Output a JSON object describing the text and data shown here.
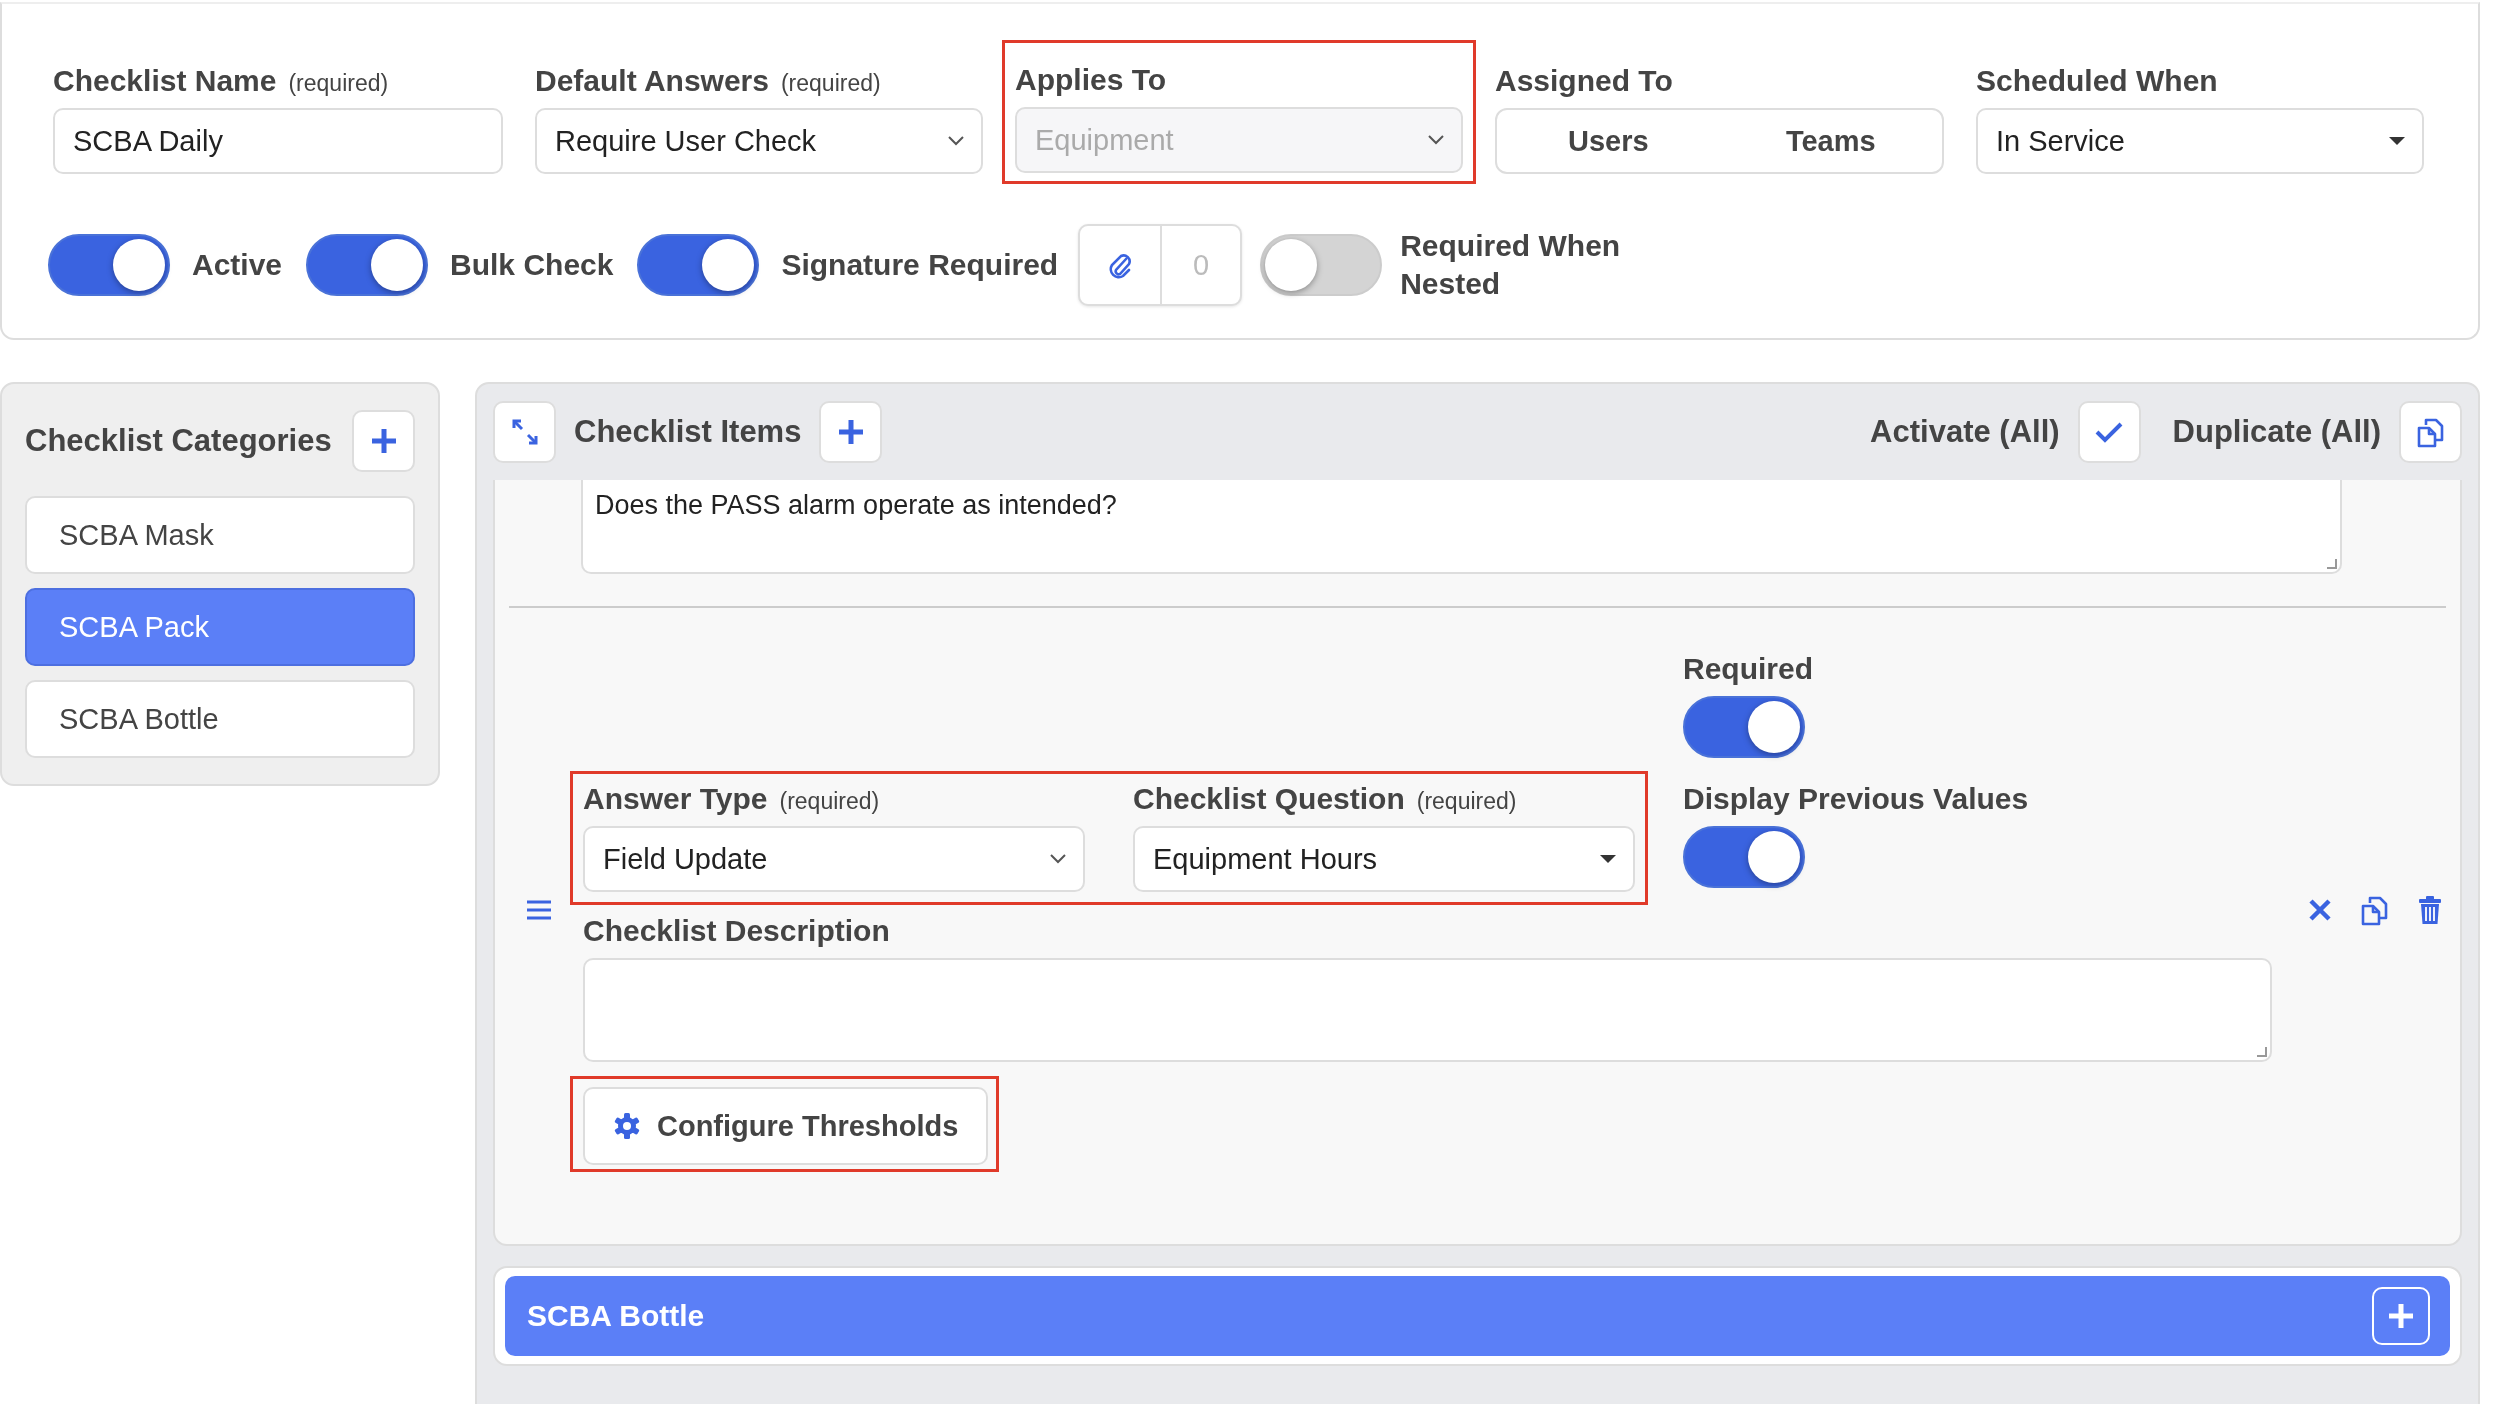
{
  "settings": {
    "fields": [
      {
        "kind": "text",
        "label": "Checklist Name",
        "note": "(required)",
        "value": "SCBA Daily",
        "highlighted": false,
        "disabled": false
      },
      {
        "kind": "select",
        "label": "Default Answers",
        "note": "(required)",
        "value": "Require User Check",
        "highlighted": false,
        "disabled": false
      },
      {
        "kind": "select",
        "label": "Applies To",
        "value": "Equipment",
        "highlighted": true,
        "disabled": true
      },
      {
        "kind": "segmented",
        "label": "Assigned To",
        "options": [
          {
            "label": "Users",
            "selected": false
          },
          {
            "label": "Teams",
            "selected": false
          }
        ]
      },
      {
        "kind": "dropdown",
        "label": "Scheduled When",
        "value": "In Service",
        "highlighted": false,
        "disabled": false
      }
    ],
    "switches": [
      {
        "kind": "toggle",
        "label": "Active",
        "on": true
      },
      {
        "kind": "toggle",
        "label": "Bulk Check",
        "on": true
      },
      {
        "kind": "toggle",
        "label": "Signature Required",
        "on": true
      },
      {
        "kind": "attachments",
        "count": "0"
      },
      {
        "kind": "toggle",
        "label": "Required When Nested",
        "on": false
      }
    ]
  },
  "categories": {
    "title": "Checklist Categories",
    "items": [
      {
        "label": "SCBA Mask",
        "selected": false
      },
      {
        "label": "SCBA Pack",
        "selected": true
      },
      {
        "label": "SCBA Bottle",
        "selected": false
      }
    ]
  },
  "items_panel": {
    "title": "Checklist Items",
    "activate_all": "Activate (All)",
    "duplicate_all": "Duplicate (All)",
    "previous_item": {
      "description": "Does the PASS alarm operate as intended?"
    },
    "item": {
      "required": {
        "label": "Required",
        "on": true
      },
      "display_previous": {
        "label": "Display Previous Values",
        "on": true
      },
      "fields_highlighted": true,
      "answer_type": {
        "label": "Answer Type",
        "note": "(required)",
        "value": "Field Update"
      },
      "question": {
        "label": "Checklist Question",
        "note": "(required)",
        "value": "Equipment Hours"
      },
      "description": {
        "label": "Checklist Description"
      },
      "configure": {
        "label": "Configure Thresholds",
        "highlighted": true
      }
    },
    "next_category": {
      "label": "SCBA Bottle"
    }
  }
}
